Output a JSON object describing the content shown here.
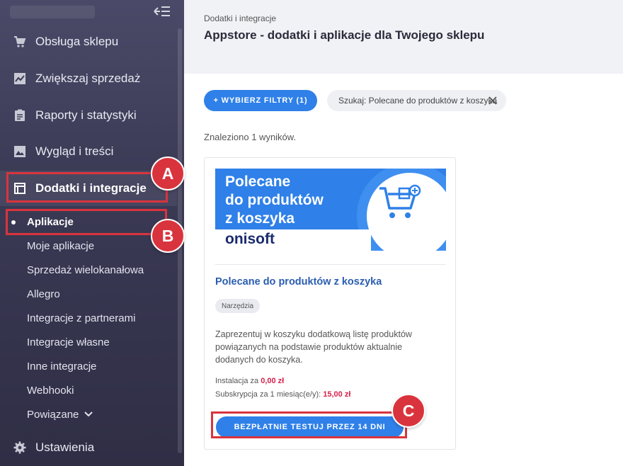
{
  "sidebar": {
    "menu": [
      {
        "label": "Obsługa sklepu",
        "icon": "cart-icon"
      },
      {
        "label": "Zwiększaj sprzedaż",
        "icon": "chart-line-icon"
      },
      {
        "label": "Raporty i statystyki",
        "icon": "clipboard-icon"
      },
      {
        "label": "Wygląd i treści",
        "icon": "image-icon"
      },
      {
        "label": "Dodatki i integracje",
        "icon": "window-icon",
        "active": true
      }
    ],
    "submenu": [
      {
        "label": "Aplikacje",
        "active": true
      },
      {
        "label": "Moje aplikacje"
      },
      {
        "label": "Sprzedaż wielokanałowa"
      },
      {
        "label": "Allegro"
      },
      {
        "label": "Integracje z partnerami"
      },
      {
        "label": "Integracje własne"
      },
      {
        "label": "Inne integracje"
      },
      {
        "label": "Webhooki"
      },
      {
        "label": "Powiązane"
      }
    ],
    "settings_label": "Ustawienia"
  },
  "header": {
    "breadcrumb": "Dodatki i integracje",
    "title": "Appstore - dodatki i aplikacje dla Twojego sklepu"
  },
  "filters": {
    "button_label": "+ WYBIERZ FILTRY (1)",
    "search_chip": "Szukaj: Polecane do produktów z koszyka"
  },
  "results_text": "Znaleziono 1 wyników.",
  "card": {
    "banner_title_lines": [
      "Polecane",
      "do produktów",
      "z koszyka"
    ],
    "banner_logo": "onisoft",
    "title": "Polecane do produktów z koszyka",
    "tag": "Narzędzia",
    "description": "Zaprezentuj w koszyku dodatkową listę produktów powiązanych na podstawie produktów aktualnie dodanych do koszyka.",
    "install_label": "Instalacja za",
    "install_price": "0,00 zł",
    "subscription_label": "Subskrypcja za 1 miesiąc(e/y):",
    "subscription_price": "15,00 zł",
    "trial_button": "BEZPŁATNIE TESTUJ PRZEZ 14 DNI"
  },
  "annotations": {
    "markers": [
      "A",
      "B",
      "C"
    ],
    "color": "#d9343d"
  },
  "colors": {
    "accent": "#2f80e8",
    "price": "#d8204a",
    "sidebar_bg": "#3b3a55"
  }
}
